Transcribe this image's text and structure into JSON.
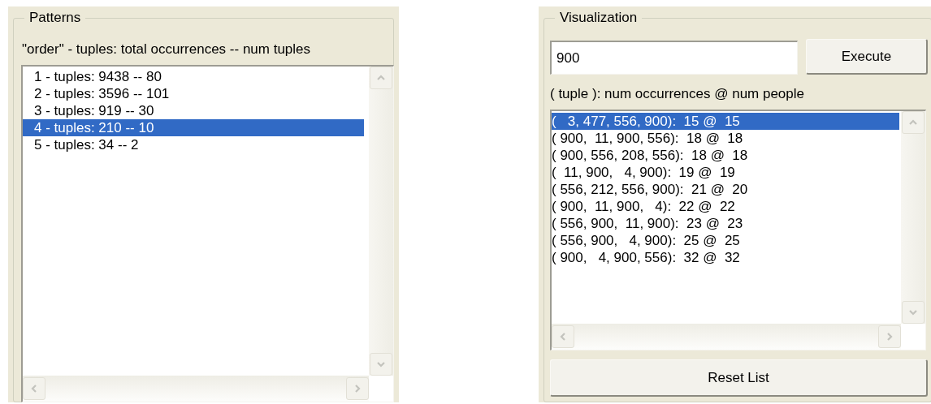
{
  "patterns": {
    "title": "Patterns",
    "header": "\"order\" - tuples: total occurrences -- num tuples",
    "items": [
      {
        "label": "1 - tuples: 9438 -- 80",
        "selected": false
      },
      {
        "label": "2 - tuples: 3596 -- 101",
        "selected": false
      },
      {
        "label": "3 - tuples: 919 -- 30",
        "selected": false
      },
      {
        "label": "4 - tuples: 210 -- 10",
        "selected": true
      },
      {
        "label": "5 - tuples: 34 -- 2",
        "selected": false
      }
    ]
  },
  "visualization": {
    "title": "Visualization",
    "input_value": "900",
    "execute_button": "Execute",
    "header": "( tuple ): num occurrences @ num people",
    "items": [
      {
        "label": "(   3, 477, 556, 900):  15 @  15",
        "selected": true
      },
      {
        "label": "( 900,  11, 900, 556):  18 @  18",
        "selected": false
      },
      {
        "label": "( 900, 556, 208, 556):  18 @  18",
        "selected": false
      },
      {
        "label": "(  11, 900,   4, 900):  19 @  19",
        "selected": false
      },
      {
        "label": "( 556, 212, 556, 900):  21 @  20",
        "selected": false
      },
      {
        "label": "( 900,  11, 900,   4):  22 @  22",
        "selected": false
      },
      {
        "label": "( 556, 900,  11, 900):  23 @  23",
        "selected": false
      },
      {
        "label": "( 556, 900,   4, 900):  25 @  25",
        "selected": false
      },
      {
        "label": "( 900,   4, 900, 556):  32 @  32",
        "selected": false
      }
    ],
    "reset_button": "Reset List"
  }
}
